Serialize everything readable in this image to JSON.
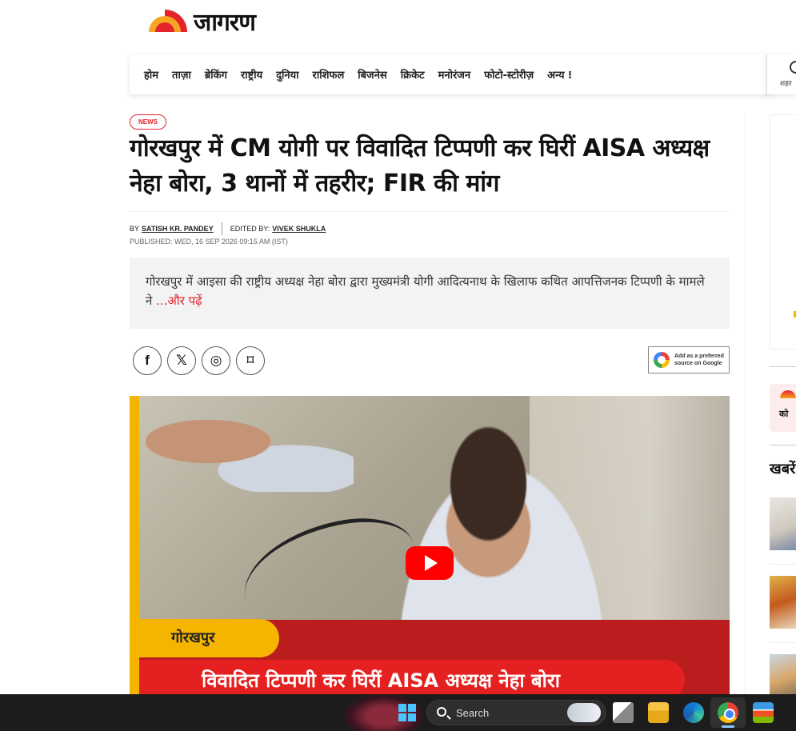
{
  "logo": {
    "text": "जागरण"
  },
  "nav": {
    "items": [
      "होम",
      "ताज़ा",
      "ब्रेकिंग",
      "राष्ट्रीय",
      "दुनिया",
      "राशिफल",
      "बिजनेस",
      "क्रिकेट",
      "मनोरंजन",
      "फोटो-स्टोरीज़",
      "अन्य ⁝"
    ],
    "city_label": "शहर"
  },
  "article": {
    "tag": "NEWS",
    "headline": "गोरखपुर में CM योगी पर विवादित टिप्पणी कर घिरीं AISA अध्यक्ष नेहा बोरा, 3 थानों में तहरीर; FIR की मांग",
    "by_prefix": "BY",
    "author": "SATISH KR. PANDEY",
    "edited_prefix": "EDITED BY:",
    "editor": "VIVEK SHUKLA",
    "published": "PUBLISHED: WED, 16 SEP 2026 09:15 AM (IST)",
    "summary": "गोरखपुर में आइसा की राष्ट्रीय अध्यक्ष नेहा बोरा द्वारा मुख्यमंत्री योगी आदित्यनाथ के खिलाफ कथित आपत्तिजनक टिप्पणी के मामले ने",
    "read_more": "...और पढ़ें",
    "google_badge_line1": "Add as a preferred",
    "google_badge_line2": "source on Google"
  },
  "share": {
    "facebook": "f",
    "x": "𝕏",
    "whatsapp": "◎",
    "bookmark": "⌑"
  },
  "video": {
    "location_tag": "गोरखपुर",
    "title_band": "विवादित टिप्पणी कर घिरीं AISA अध्यक्ष नेहा बोरा"
  },
  "sidebar": {
    "card_text": "को",
    "heading": "खबरें"
  },
  "taskbar": {
    "search_label": "Search"
  },
  "colors": {
    "brand_red": "#e4232b",
    "accent_yellow": "#f4b400",
    "youtube_red": "#ff0000"
  }
}
